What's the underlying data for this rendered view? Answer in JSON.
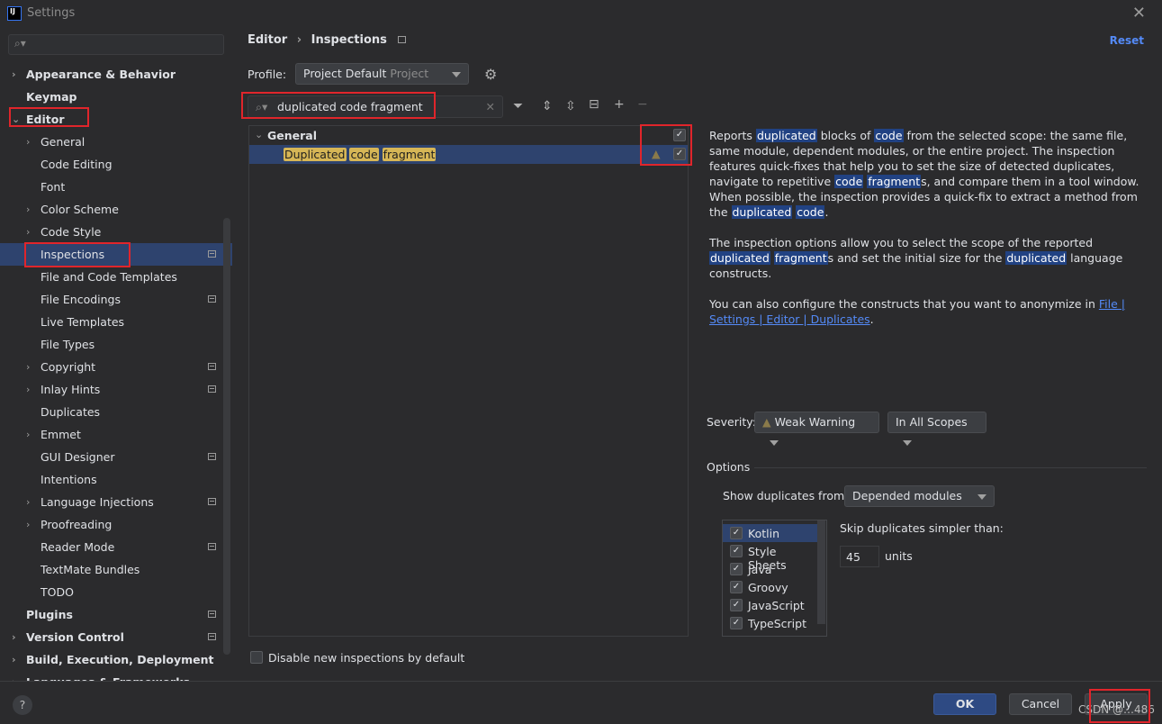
{
  "window": {
    "title": "Settings",
    "logo": "IJ"
  },
  "sidebar": {
    "search_placeholder": "",
    "items": [
      {
        "label": "Appearance & Behavior",
        "bold": true,
        "level": 0,
        "chevron": "right"
      },
      {
        "label": "Keymap",
        "bold": true,
        "level": 0
      },
      {
        "label": "Editor",
        "bold": true,
        "level": 0,
        "chevron": "down"
      },
      {
        "label": "General",
        "level": 1,
        "chevron": "right"
      },
      {
        "label": "Code Editing",
        "level": 1
      },
      {
        "label": "Font",
        "level": 1
      },
      {
        "label": "Color Scheme",
        "level": 1,
        "chevron": "right"
      },
      {
        "label": "Code Style",
        "level": 1,
        "chevron": "right"
      },
      {
        "label": "Inspections",
        "level": 1,
        "selected": true,
        "mini": true
      },
      {
        "label": "File and Code Templates",
        "level": 1
      },
      {
        "label": "File Encodings",
        "level": 1,
        "mini": true
      },
      {
        "label": "Live Templates",
        "level": 1
      },
      {
        "label": "File Types",
        "level": 1
      },
      {
        "label": "Copyright",
        "level": 1,
        "chevron": "right",
        "mini": true
      },
      {
        "label": "Inlay Hints",
        "level": 1,
        "chevron": "right",
        "mini": true
      },
      {
        "label": "Duplicates",
        "level": 1
      },
      {
        "label": "Emmet",
        "level": 1,
        "chevron": "right"
      },
      {
        "label": "GUI Designer",
        "level": 1,
        "mini": true
      },
      {
        "label": "Intentions",
        "level": 1
      },
      {
        "label": "Language Injections",
        "level": 1,
        "chevron": "right",
        "mini": true
      },
      {
        "label": "Proofreading",
        "level": 1,
        "chevron": "right"
      },
      {
        "label": "Reader Mode",
        "level": 1,
        "mini": true
      },
      {
        "label": "TextMate Bundles",
        "level": 1
      },
      {
        "label": "TODO",
        "level": 1
      },
      {
        "label": "Plugins",
        "bold": true,
        "level": 0,
        "mini": true
      },
      {
        "label": "Version Control",
        "bold": true,
        "level": 0,
        "chevron": "right",
        "mini": true
      },
      {
        "label": "Build, Execution, Deployment",
        "bold": true,
        "level": 0,
        "chevron": "right"
      },
      {
        "label": "Languages & Frameworks",
        "bold": true,
        "level": 0,
        "chevron": "right"
      }
    ]
  },
  "header": {
    "breadcrumb": [
      "Editor",
      "Inspections"
    ],
    "reset": "Reset"
  },
  "profile": {
    "label": "Profile:",
    "value": "Project Default",
    "scope": "Project"
  },
  "filter": {
    "value": "duplicated code fragment"
  },
  "tree": {
    "group": "General",
    "item_words": [
      "Duplicated",
      "code",
      "fragment"
    ],
    "group_checked": true,
    "item_checked": true
  },
  "description": {
    "p1": [
      [
        "Reports ",
        0
      ],
      [
        "duplicated",
        1
      ],
      [
        " blocks of ",
        0
      ],
      [
        "code",
        1
      ],
      [
        " from the selected scope: the same file, same module, dependent modules, or the entire project. The inspection features quick-fixes that help you to set the size of detected duplicates, navigate to repetitive ",
        0
      ],
      [
        "code",
        1
      ],
      [
        " ",
        0
      ],
      [
        "fragment",
        1
      ],
      [
        "s, and compare them in a tool window. When possible, the inspection provides a quick-fix to extract a method from the ",
        0
      ],
      [
        "duplicated",
        1
      ],
      [
        " ",
        0
      ],
      [
        "code",
        1
      ],
      [
        ".",
        0
      ]
    ],
    "p2": [
      [
        "The inspection options allow you to select the scope of the reported ",
        0
      ],
      [
        "duplicated",
        1
      ],
      [
        " ",
        0
      ],
      [
        "fragment",
        1
      ],
      [
        "s and set the initial size for the ",
        0
      ],
      [
        "duplicated",
        1
      ],
      [
        " language constructs.",
        0
      ]
    ],
    "p3_text": "You can also configure the constructs that you want to anonymize in ",
    "p3_link": "File | Settings | Editor | Duplicates",
    "p3_end": "."
  },
  "severity": {
    "label": "Severity:",
    "value": "Weak Warning",
    "scope": "In All Scopes"
  },
  "options": {
    "title": "Options",
    "show_from_label": "Show duplicates from:",
    "show_from_value": "Depended modules",
    "languages": [
      {
        "name": "Kotlin",
        "checked": true
      },
      {
        "name": "Style Sheets",
        "checked": true
      },
      {
        "name": "Java",
        "checked": true
      },
      {
        "name": "Groovy",
        "checked": true
      },
      {
        "name": "JavaScript",
        "checked": true
      },
      {
        "name": "TypeScript",
        "checked": true
      }
    ],
    "skip_label": "Skip duplicates simpler than:",
    "skip_value": "45",
    "skip_unit": "units"
  },
  "disable_new": {
    "label": "Disable new inspections by default",
    "checked": false
  },
  "buttons": {
    "ok": "OK",
    "cancel": "Cancel",
    "apply": "Apply",
    "help": "?"
  },
  "watermark": "CSDN @…486",
  "colors": {
    "accent": "#548af7",
    "selection": "#2e436e",
    "highlight": "#d6b656",
    "annotation": "#e0252b"
  }
}
